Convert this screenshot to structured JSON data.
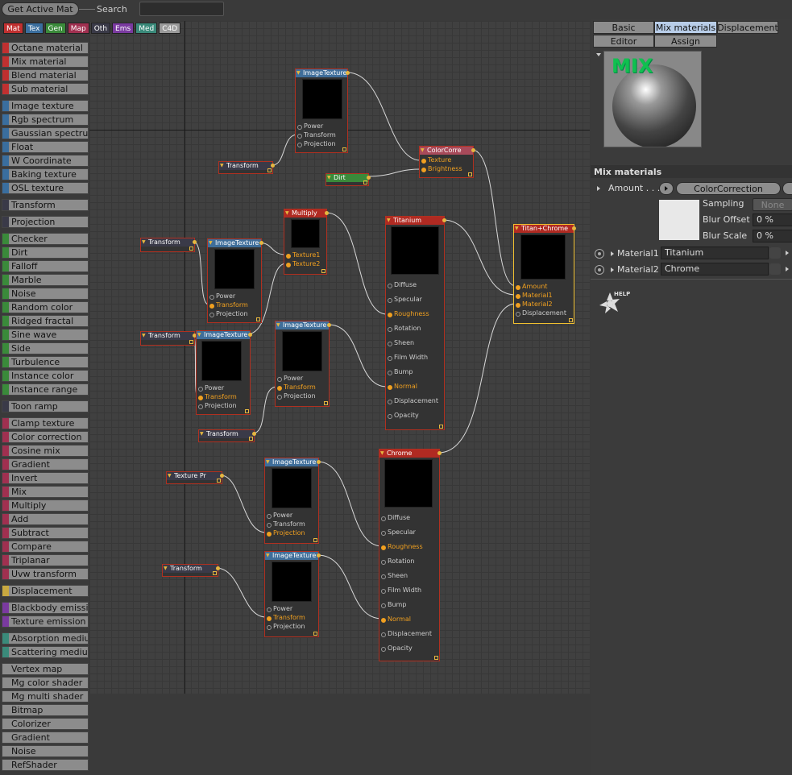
{
  "toolbar": {
    "get_active_mat": "Get Active Mat",
    "search_label": "Search",
    "search_value": ""
  },
  "categories": [
    {
      "label": "Mat",
      "color": "#c03030"
    },
    {
      "label": "Tex",
      "color": "#3a6e9e"
    },
    {
      "label": "Gen",
      "color": "#3a8a3a"
    },
    {
      "label": "Map",
      "color": "#a03050"
    },
    {
      "label": "Oth",
      "color": "#3a3a48"
    },
    {
      "label": "Ems",
      "color": "#7a3aa0"
    },
    {
      "label": "Med",
      "color": "#3a8a7a"
    },
    {
      "label": "C4D",
      "color": "#9a9a9a"
    }
  ],
  "palette": [
    {
      "label": "Octane material",
      "color": "#c03030"
    },
    {
      "label": "Mix material",
      "color": "#c03030"
    },
    {
      "label": "Blend material",
      "color": "#c03030"
    },
    {
      "label": "Sub material",
      "color": "#c03030"
    },
    {
      "label": "Image texture",
      "color": "#3a6e9e"
    },
    {
      "label": "Rgb spectrum",
      "color": "#3a6e9e"
    },
    {
      "label": "Gaussian spectrum",
      "color": "#3a6e9e"
    },
    {
      "label": "Float",
      "color": "#3a6e9e"
    },
    {
      "label": "W Coordinate",
      "color": "#3a6e9e"
    },
    {
      "label": "Baking texture",
      "color": "#3a6e9e"
    },
    {
      "label": "OSL texture",
      "color": "#3a6e9e"
    },
    {
      "label": "Transform",
      "color": "#3a3a48"
    },
    {
      "label": "Projection",
      "color": "#3a3a48"
    },
    {
      "label": "Checker",
      "color": "#3a8a3a"
    },
    {
      "label": "Dirt",
      "color": "#3a8a3a"
    },
    {
      "label": "Falloff",
      "color": "#3a8a3a"
    },
    {
      "label": "Marble",
      "color": "#3a8a3a"
    },
    {
      "label": "Noise",
      "color": "#3a8a3a"
    },
    {
      "label": "Random color",
      "color": "#3a8a3a"
    },
    {
      "label": "Ridged fractal",
      "color": "#3a8a3a"
    },
    {
      "label": "Sine wave",
      "color": "#3a8a3a"
    },
    {
      "label": "Side",
      "color": "#3a8a3a"
    },
    {
      "label": "Turbulence",
      "color": "#3a8a3a"
    },
    {
      "label": "Instance color",
      "color": "#3a8a3a"
    },
    {
      "label": "Instance range",
      "color": "#3a8a3a"
    },
    {
      "label": "Toon ramp",
      "color": "#3a3a48"
    },
    {
      "label": "Clamp texture",
      "color": "#a03050"
    },
    {
      "label": "Color correction",
      "color": "#a03050"
    },
    {
      "label": "Cosine mix",
      "color": "#a03050"
    },
    {
      "label": "Gradient",
      "color": "#a03050"
    },
    {
      "label": "Invert",
      "color": "#a03050"
    },
    {
      "label": "Mix",
      "color": "#a03050"
    },
    {
      "label": "Multiply",
      "color": "#a03050"
    },
    {
      "label": "Add",
      "color": "#a03050"
    },
    {
      "label": "Subtract",
      "color": "#a03050"
    },
    {
      "label": "Compare",
      "color": "#a03050"
    },
    {
      "label": "Triplanar",
      "color": "#a03050"
    },
    {
      "label": "Uvw transform",
      "color": "#a03050"
    },
    {
      "label": "Displacement",
      "color": "#c8a840"
    },
    {
      "label": "Blackbody emission",
      "color": "#7a3aa0"
    },
    {
      "label": "Texture emission",
      "color": "#7a3aa0"
    },
    {
      "label": "Absorption medium",
      "color": "#3a8a7a"
    },
    {
      "label": "Scattering medium",
      "color": "#3a8a7a"
    },
    {
      "label": "Vertex map",
      "color": "#8c8c8c"
    },
    {
      "label": "Mg color shader",
      "color": "#8c8c8c"
    },
    {
      "label": "Mg multi shader",
      "color": "#8c8c8c"
    },
    {
      "label": "Bitmap",
      "color": "#8c8c8c"
    },
    {
      "label": "Colorizer",
      "color": "#8c8c8c"
    },
    {
      "label": "Gradient",
      "color": "#8c8c8c"
    },
    {
      "label": "Noise",
      "color": "#8c8c8c"
    },
    {
      "label": "RefShader",
      "color": "#8c8c8c"
    }
  ],
  "nodes": {
    "img1": {
      "title": "ImageTexture",
      "pins": [
        "Power",
        "Transform",
        "Projection"
      ]
    },
    "transform1": {
      "title": "Transform"
    },
    "colorcorr": {
      "title": "ColorCorre",
      "pins": [
        "Texture",
        "Brightness"
      ]
    },
    "dirt": {
      "title": "Dirt"
    },
    "multiply": {
      "title": "Multiply",
      "pins": [
        "Texture1",
        "Texture2"
      ]
    },
    "transform2": {
      "title": "Transform"
    },
    "img2": {
      "title": "ImageTexture",
      "pins": [
        "Power",
        "Transform",
        "Projection"
      ]
    },
    "transform3": {
      "title": "Transform"
    },
    "img3": {
      "title": "ImageTexture",
      "pins": [
        "Power",
        "Transform",
        "Projection"
      ]
    },
    "img4": {
      "title": "ImageTexture",
      "pins": [
        "Power",
        "Transform",
        "Projection"
      ]
    },
    "transform4": {
      "title": "Transform"
    },
    "titanium": {
      "title": "Titanium",
      "pins": [
        "Diffuse",
        "Specular",
        "Roughness",
        "Rotation",
        "Sheen",
        "Film Width",
        "Bump",
        "Normal",
        "Displacement",
        "Opacity"
      ]
    },
    "mixnode": {
      "title": "Titan+Chrome",
      "pins": [
        "Amount",
        "Material1",
        "Material2",
        "Displacement"
      ]
    },
    "texproj": {
      "title": "Texture Pr"
    },
    "img5": {
      "title": "ImageTexture",
      "pins": [
        "Power",
        "Transform",
        "Projection"
      ]
    },
    "chrome": {
      "title": "Chrome",
      "pins": [
        "Diffuse",
        "Specular",
        "Roughness",
        "Rotation",
        "Sheen",
        "Film Width",
        "Bump",
        "Normal",
        "Displacement",
        "Opacity"
      ]
    },
    "transform5": {
      "title": "Transform"
    },
    "img6": {
      "title": "ImageTexture",
      "pins": [
        "Power",
        "Transform",
        "Projection"
      ]
    }
  },
  "tabs": {
    "basic": "Basic",
    "mix": "Mix materials",
    "displacement": "Displacement",
    "editor": "Editor",
    "assign": "Assign"
  },
  "preview": {
    "logo": "MIX"
  },
  "props": {
    "title": "Mix materials",
    "amount_label": "Amount . . .",
    "amount_value": "ColorCorrection",
    "sampling_label": "Sampling",
    "sampling_value": "None",
    "blur_offset_label": "Blur Offset",
    "blur_offset_value": "0 %",
    "blur_scale_label": "Blur Scale",
    "blur_scale_value": "0 %",
    "material1_label": "Material1",
    "material1_value": "Titanium",
    "material2_label": "Material2",
    "material2_value": "Chrome",
    "help": "HELP"
  }
}
